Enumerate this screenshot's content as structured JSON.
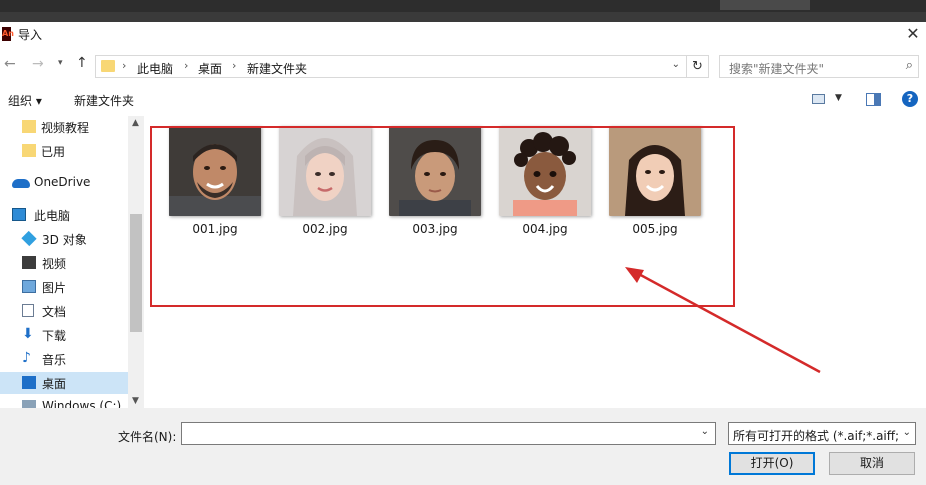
{
  "dialog": {
    "app_icon_text": "An",
    "title": "导入",
    "close_glyph": "✕"
  },
  "nav": {
    "back_glyph": "←",
    "forward_glyph": "→",
    "recent_glyph": "▾",
    "up_glyph": "↑",
    "breadcrumb": [
      "此电脑",
      "桌面",
      "新建文件夹"
    ],
    "breadcrumb_sep": "›",
    "dropdown_glyph": "⌄",
    "refresh_glyph": "↻",
    "search_placeholder": "搜索\"新建文件夹\"",
    "search_glyph": "⌕"
  },
  "toolbar": {
    "organize_label": "组织 ▾",
    "new_folder_label": "新建文件夹",
    "view_dropdown_glyph": "▼",
    "help_glyph": "?"
  },
  "sidebar": {
    "items": [
      {
        "label": "视频教程",
        "icon": "folder-icon"
      },
      {
        "label": "已用",
        "icon": "folder-icon"
      },
      {
        "label": "OneDrive",
        "icon": "cloud-icon"
      },
      {
        "label": "此电脑",
        "icon": "computer-icon"
      },
      {
        "label": "3D 对象",
        "icon": "3d-objects-icon"
      },
      {
        "label": "视频",
        "icon": "video-icon"
      },
      {
        "label": "图片",
        "icon": "pictures-icon"
      },
      {
        "label": "文档",
        "icon": "documents-icon"
      },
      {
        "label": "下载",
        "icon": "download-icon"
      },
      {
        "label": "音乐",
        "icon": "music-icon"
      },
      {
        "label": "桌面",
        "icon": "desktop-icon"
      },
      {
        "label": "Windows (C:)",
        "icon": "disk-icon"
      }
    ],
    "download_glyph": "⬇",
    "music_glyph": "♪",
    "scroll_up_glyph": "▲",
    "scroll_down_glyph": "▼"
  },
  "files": [
    {
      "name": "001.jpg",
      "thumbnail": "portrait-photo"
    },
    {
      "name": "002.jpg",
      "thumbnail": "portrait-photo"
    },
    {
      "name": "003.jpg",
      "thumbnail": "portrait-photo"
    },
    {
      "name": "004.jpg",
      "thumbnail": "portrait-photo"
    },
    {
      "name": "005.jpg",
      "thumbnail": "portrait-photo"
    }
  ],
  "bottom": {
    "filename_label": "文件名(N):",
    "filename_value": "",
    "filetype_selected": "所有可打开的格式 (*.aif;*.aiff;*",
    "open_button": "打开(O)",
    "cancel_button": "取消",
    "dropdown_glyph": "⌄"
  },
  "colors": {
    "annotation_red": "#d42a2a",
    "selection_blue": "#cce4f7",
    "accent_blue": "#0078d7"
  }
}
